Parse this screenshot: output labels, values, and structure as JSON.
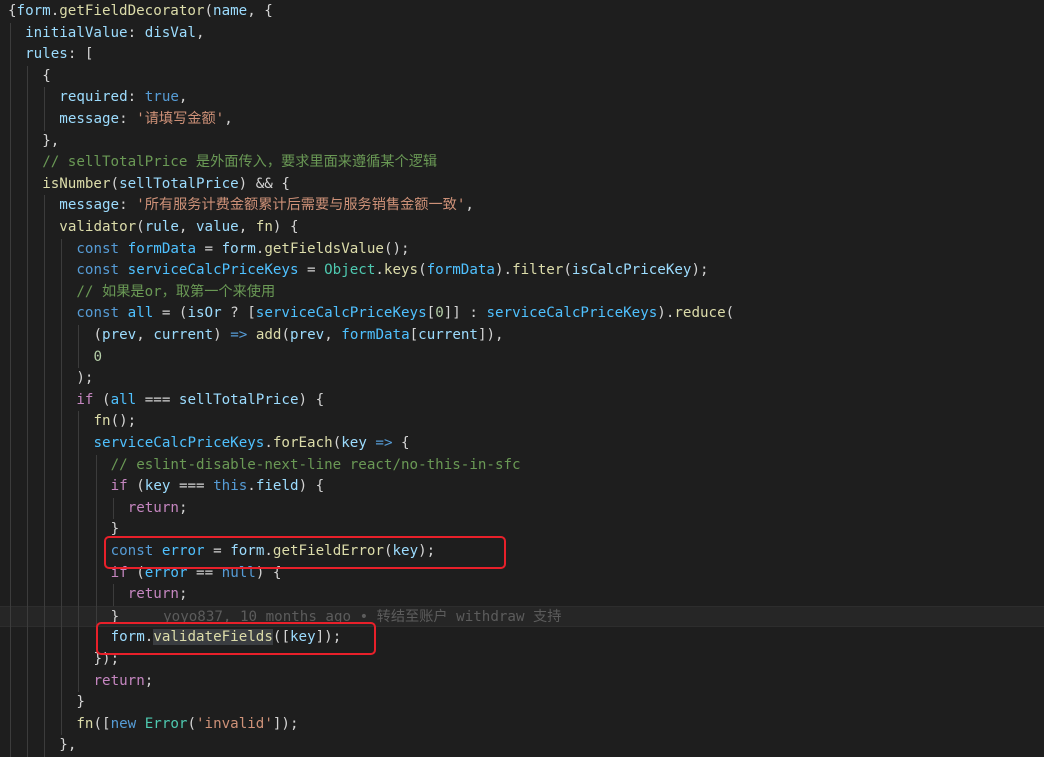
{
  "theme": {
    "bg": "#1e1e1e",
    "plain": "#d4d4d4",
    "keyword": "#569cd6",
    "control": "#c586c0",
    "variable": "#9cdcfe",
    "function": "#dcdcaa",
    "string": "#ce9178",
    "number": "#b5cea8",
    "comment": "#6a9955",
    "type": "#4ec9b0",
    "constant": "#4fc1ff",
    "highlight_box": "#e8202a"
  },
  "lines": [
    {
      "indent": 0,
      "tokens": [
        [
          "{",
          "plain"
        ],
        [
          "form",
          "variable"
        ],
        [
          ".",
          "plain"
        ],
        [
          "getFieldDecorator",
          "function"
        ],
        [
          "(",
          "plain"
        ],
        [
          "name",
          "variable"
        ],
        [
          ", {",
          "plain"
        ]
      ]
    },
    {
      "indent": 1,
      "tokens": [
        [
          "initialValue",
          "variable"
        ],
        [
          ": ",
          "plain"
        ],
        [
          "disVal",
          "variable"
        ],
        [
          ",",
          "plain"
        ]
      ]
    },
    {
      "indent": 1,
      "tokens": [
        [
          "rules",
          "variable"
        ],
        [
          ": [",
          "plain"
        ]
      ]
    },
    {
      "indent": 2,
      "tokens": [
        [
          "{",
          "plain"
        ]
      ]
    },
    {
      "indent": 3,
      "tokens": [
        [
          "required",
          "variable"
        ],
        [
          ": ",
          "plain"
        ],
        [
          "true",
          "keyword"
        ],
        [
          ",",
          "plain"
        ]
      ]
    },
    {
      "indent": 3,
      "tokens": [
        [
          "message",
          "variable"
        ],
        [
          ": ",
          "plain"
        ],
        [
          "'请填写金额'",
          "string"
        ],
        [
          ",",
          "plain"
        ]
      ]
    },
    {
      "indent": 2,
      "tokens": [
        [
          "},",
          "plain"
        ]
      ]
    },
    {
      "indent": 2,
      "tokens": [
        [
          "// sellTotalPrice 是外面传入，要求里面来遵循某个逻辑",
          "comment"
        ]
      ]
    },
    {
      "indent": 2,
      "tokens": [
        [
          "isNumber",
          "function"
        ],
        [
          "(",
          "plain"
        ],
        [
          "sellTotalPrice",
          "variable"
        ],
        [
          ") && {",
          "plain"
        ]
      ]
    },
    {
      "indent": 3,
      "tokens": [
        [
          "message",
          "variable"
        ],
        [
          ": ",
          "plain"
        ],
        [
          "'所有服务计费金额累计后需要与服务销售金额一致'",
          "string"
        ],
        [
          ",",
          "plain"
        ]
      ]
    },
    {
      "indent": 3,
      "tokens": [
        [
          "validator",
          "function"
        ],
        [
          "(",
          "plain"
        ],
        [
          "rule",
          "variable"
        ],
        [
          ", ",
          "plain"
        ],
        [
          "value",
          "variable"
        ],
        [
          ", ",
          "plain"
        ],
        [
          "fn",
          "function"
        ],
        [
          ") {",
          "plain"
        ]
      ]
    },
    {
      "indent": 4,
      "tokens": [
        [
          "const",
          "keyword"
        ],
        [
          " ",
          "plain"
        ],
        [
          "formData",
          "constant"
        ],
        [
          " = ",
          "plain"
        ],
        [
          "form",
          "variable"
        ],
        [
          ".",
          "plain"
        ],
        [
          "getFieldsValue",
          "function"
        ],
        [
          "();",
          "plain"
        ]
      ]
    },
    {
      "indent": 4,
      "tokens": [
        [
          "const",
          "keyword"
        ],
        [
          " ",
          "plain"
        ],
        [
          "serviceCalcPriceKeys",
          "constant"
        ],
        [
          " = ",
          "plain"
        ],
        [
          "Object",
          "type"
        ],
        [
          ".",
          "plain"
        ],
        [
          "keys",
          "function"
        ],
        [
          "(",
          "plain"
        ],
        [
          "formData",
          "constant"
        ],
        [
          ").",
          "plain"
        ],
        [
          "filter",
          "function"
        ],
        [
          "(",
          "plain"
        ],
        [
          "isCalcPriceKey",
          "variable"
        ],
        [
          ");",
          "plain"
        ]
      ]
    },
    {
      "indent": 4,
      "tokens": [
        [
          "// 如果是or，取第一个来使用",
          "comment"
        ]
      ]
    },
    {
      "indent": 4,
      "tokens": [
        [
          "const",
          "keyword"
        ],
        [
          " ",
          "plain"
        ],
        [
          "all",
          "constant"
        ],
        [
          " = (",
          "plain"
        ],
        [
          "isOr",
          "variable"
        ],
        [
          " ? [",
          "plain"
        ],
        [
          "serviceCalcPriceKeys",
          "constant"
        ],
        [
          "[",
          "plain"
        ],
        [
          "0",
          "number"
        ],
        [
          "]] : ",
          "plain"
        ],
        [
          "serviceCalcPriceKeys",
          "constant"
        ],
        [
          ").",
          "plain"
        ],
        [
          "reduce",
          "function"
        ],
        [
          "(",
          "plain"
        ]
      ]
    },
    {
      "indent": 5,
      "tokens": [
        [
          "(",
          "plain"
        ],
        [
          "prev",
          "variable"
        ],
        [
          ", ",
          "plain"
        ],
        [
          "current",
          "variable"
        ],
        [
          ") ",
          "plain"
        ],
        [
          "=>",
          "keyword"
        ],
        [
          " ",
          "plain"
        ],
        [
          "add",
          "function"
        ],
        [
          "(",
          "plain"
        ],
        [
          "prev",
          "variable"
        ],
        [
          ", ",
          "plain"
        ],
        [
          "formData",
          "constant"
        ],
        [
          "[",
          "plain"
        ],
        [
          "current",
          "variable"
        ],
        [
          "]),",
          "plain"
        ]
      ]
    },
    {
      "indent": 5,
      "tokens": [
        [
          "0",
          "number"
        ]
      ]
    },
    {
      "indent": 4,
      "tokens": [
        [
          ");",
          "plain"
        ]
      ]
    },
    {
      "indent": 4,
      "tokens": [
        [
          "if",
          "control"
        ],
        [
          " (",
          "plain"
        ],
        [
          "all",
          "constant"
        ],
        [
          " === ",
          "plain"
        ],
        [
          "sellTotalPrice",
          "variable"
        ],
        [
          ") {",
          "plain"
        ]
      ]
    },
    {
      "indent": 5,
      "tokens": [
        [
          "fn",
          "function"
        ],
        [
          "();",
          "plain"
        ]
      ]
    },
    {
      "indent": 5,
      "tokens": [
        [
          "serviceCalcPriceKeys",
          "constant"
        ],
        [
          ".",
          "plain"
        ],
        [
          "forEach",
          "function"
        ],
        [
          "(",
          "plain"
        ],
        [
          "key",
          "variable"
        ],
        [
          " ",
          "plain"
        ],
        [
          "=>",
          "keyword"
        ],
        [
          " {",
          "plain"
        ]
      ]
    },
    {
      "indent": 6,
      "tokens": [
        [
          "// eslint-disable-next-line react/no-this-in-sfc",
          "comment"
        ]
      ]
    },
    {
      "indent": 6,
      "tokens": [
        [
          "if",
          "control"
        ],
        [
          " (",
          "plain"
        ],
        [
          "key",
          "variable"
        ],
        [
          " === ",
          "plain"
        ],
        [
          "this",
          "keyword"
        ],
        [
          ".",
          "plain"
        ],
        [
          "field",
          "variable"
        ],
        [
          ") {",
          "plain"
        ]
      ]
    },
    {
      "indent": 7,
      "tokens": [
        [
          "return",
          "control"
        ],
        [
          ";",
          "plain"
        ]
      ]
    },
    {
      "indent": 6,
      "tokens": [
        [
          "}",
          "plain"
        ]
      ]
    },
    {
      "indent": 6,
      "tokens": [
        [
          "const",
          "keyword"
        ],
        [
          " ",
          "plain"
        ],
        [
          "error",
          "constant"
        ],
        [
          " = ",
          "plain"
        ],
        [
          "form",
          "variable"
        ],
        [
          ".",
          "plain"
        ],
        [
          "getFieldError",
          "function"
        ],
        [
          "(",
          "plain"
        ],
        [
          "key",
          "variable"
        ],
        [
          ");",
          "plain"
        ]
      ]
    },
    {
      "indent": 6,
      "tokens": [
        [
          "if",
          "control"
        ],
        [
          " (",
          "plain"
        ],
        [
          "error",
          "constant"
        ],
        [
          " == ",
          "plain"
        ],
        [
          "null",
          "keyword"
        ],
        [
          ") {",
          "plain"
        ]
      ]
    },
    {
      "indent": 7,
      "tokens": [
        [
          "return",
          "control"
        ],
        [
          ";",
          "plain"
        ]
      ]
    },
    {
      "indent": 6,
      "tokens": [
        [
          "}",
          "plain"
        ]
      ],
      "blame": "yoyo837, 10 months ago • 转结至账户 withdraw 支持",
      "current": true
    },
    {
      "indent": 6,
      "tokens": [
        [
          "form",
          "variable"
        ],
        [
          ".",
          "plain"
        ],
        [
          "validateFields",
          "function",
          "sel"
        ],
        [
          "([",
          "plain"
        ],
        [
          "key",
          "variable"
        ],
        [
          "]);",
          "plain"
        ]
      ]
    },
    {
      "indent": 5,
      "tokens": [
        [
          "});",
          "plain"
        ]
      ]
    },
    {
      "indent": 5,
      "tokens": [
        [
          "return",
          "control"
        ],
        [
          ";",
          "plain"
        ]
      ]
    },
    {
      "indent": 4,
      "tokens": [
        [
          "}",
          "plain"
        ]
      ]
    },
    {
      "indent": 4,
      "tokens": [
        [
          "fn",
          "function"
        ],
        [
          "([",
          "plain"
        ],
        [
          "new",
          "keyword"
        ],
        [
          " ",
          "plain"
        ],
        [
          "Error",
          "type"
        ],
        [
          "(",
          "plain"
        ],
        [
          "'invalid'",
          "string"
        ],
        [
          "]);",
          "plain"
        ]
      ]
    },
    {
      "indent": 3,
      "tokens": [
        [
          "},",
          "plain"
        ]
      ]
    }
  ],
  "highlights": [
    {
      "name": "get-field-error-highlight"
    },
    {
      "name": "validate-fields-highlight"
    }
  ]
}
